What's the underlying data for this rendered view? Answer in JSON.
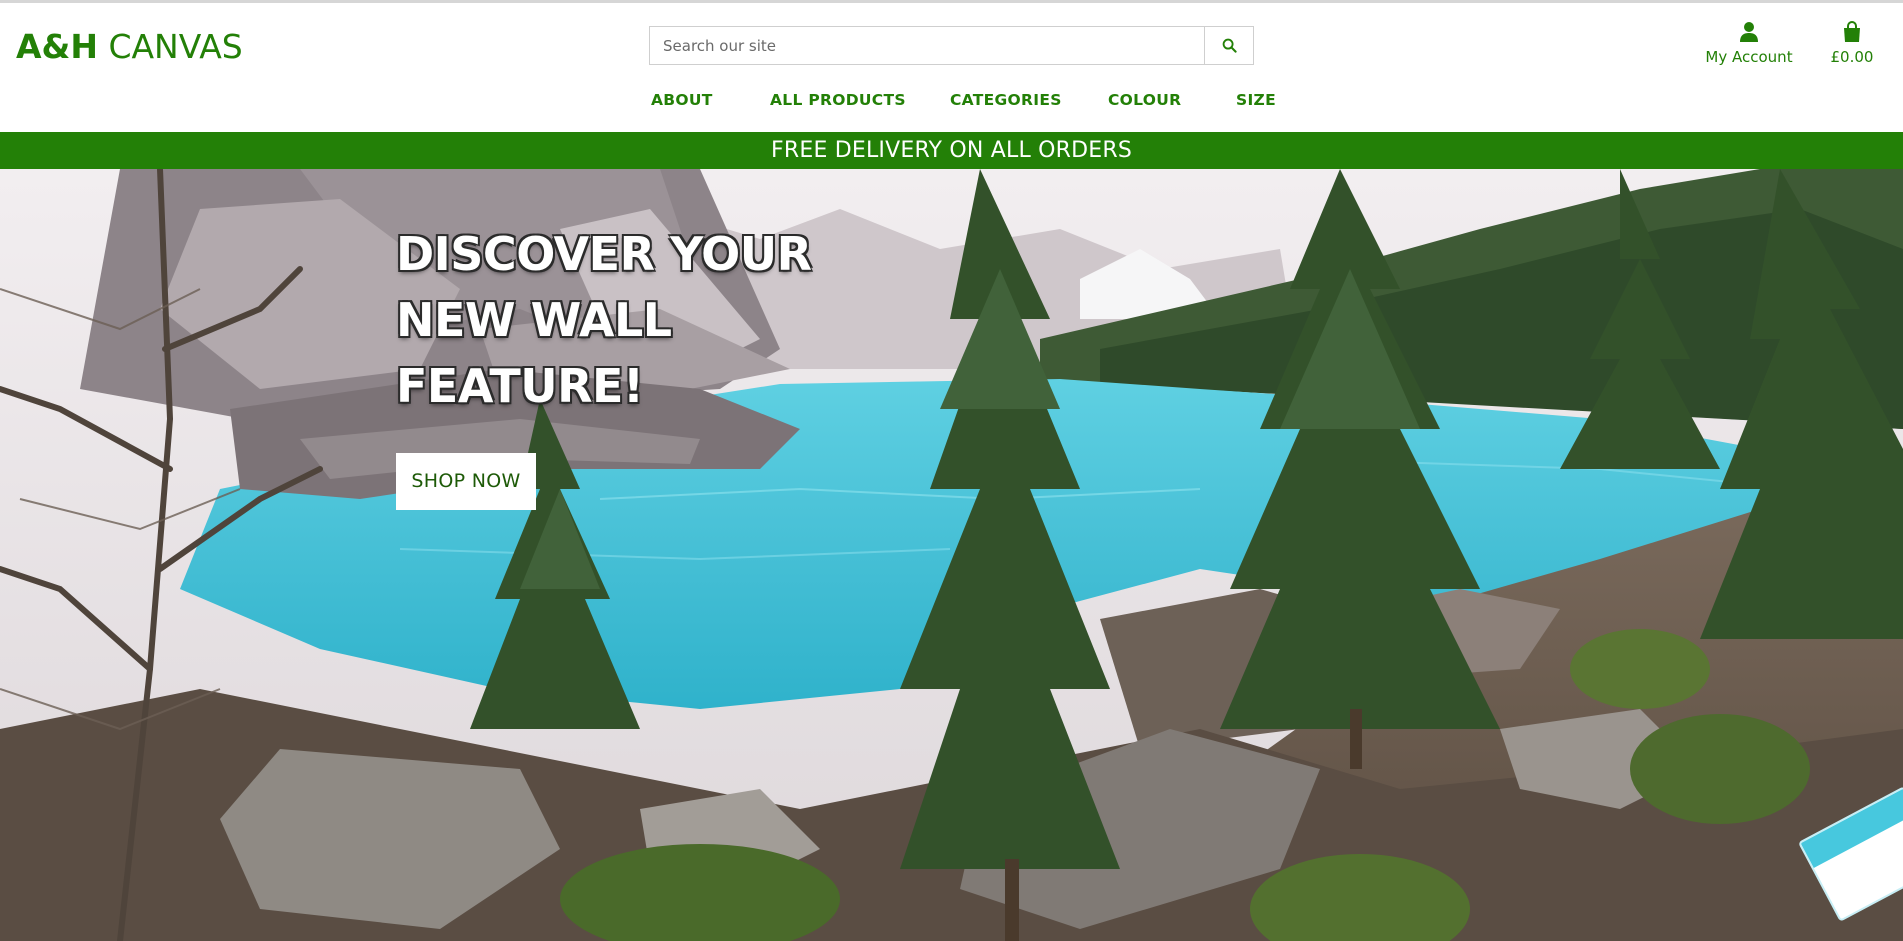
{
  "header": {
    "logo_bold": "A&H",
    "logo_light": "CANVAS",
    "search": {
      "placeholder": "Search our site",
      "icon": "search-icon"
    },
    "account": {
      "label": "My Account",
      "icon": "user-icon"
    },
    "basket": {
      "label": "£0.00",
      "icon": "shopping-bag-icon"
    }
  },
  "nav": {
    "items": [
      {
        "label": "ABOUT"
      },
      {
        "label": "ALL PRODUCTS"
      },
      {
        "label": "CATEGORIES"
      },
      {
        "label": "COLOUR"
      },
      {
        "label": "SIZE"
      }
    ]
  },
  "banner": {
    "text": "FREE DELIVERY ON ALL ORDERS"
  },
  "hero": {
    "title_lines": [
      "DISCOVER YOUR",
      "NEW WALL",
      "FEATURE!"
    ],
    "cta_label": "SHOP NOW"
  },
  "colors": {
    "brand_green": "#238007",
    "white": "#ffffff",
    "lake_turquoise": "#4ec9dd"
  }
}
